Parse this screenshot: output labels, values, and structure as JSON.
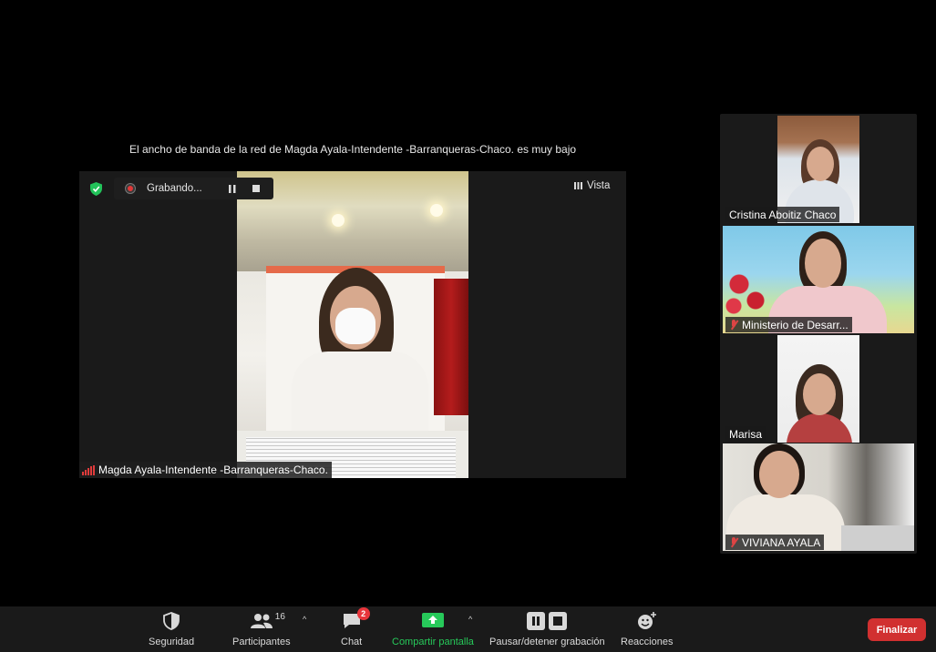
{
  "banner": {
    "text": "El ancho de banda de la red de Magda Ayala-Intendente -Barranqueras-Chaco. es muy bajo"
  },
  "recording": {
    "label": "Grabando...",
    "pause_icon": "pause-icon",
    "stop_icon": "stop-icon"
  },
  "view": {
    "label": "Vista",
    "icon": "grid-view-icon"
  },
  "main_speaker": {
    "name": "Magda Ayala-Intendente -Barranqueras-Chaco.",
    "signal_color": "#e03b3b"
  },
  "gallery": [
    {
      "name": "Cristina Aboitiz Chaco",
      "muted": false
    },
    {
      "name": "Ministerio de Desarr...",
      "muted": true
    },
    {
      "name": "Marisa",
      "muted": false
    },
    {
      "name": "VIVIANA AYALA",
      "muted": true
    }
  ],
  "toolbar": {
    "security": {
      "label": "Seguridad",
      "icon": "shield-icon"
    },
    "participants": {
      "label": "Participantes",
      "count": "16",
      "icon": "participants-icon"
    },
    "chat": {
      "label": "Chat",
      "badge": "2",
      "icon": "chat-bubble-icon"
    },
    "share": {
      "label": "Compartir pantalla",
      "icon": "share-screen-icon",
      "color": "#27c95a"
    },
    "recording": {
      "label": "Pausar/detener grabación"
    },
    "reactions": {
      "label": "Reacciones",
      "icon": "emoji-add-icon"
    },
    "end": {
      "label": "Finalizar",
      "color": "#d13030"
    }
  }
}
